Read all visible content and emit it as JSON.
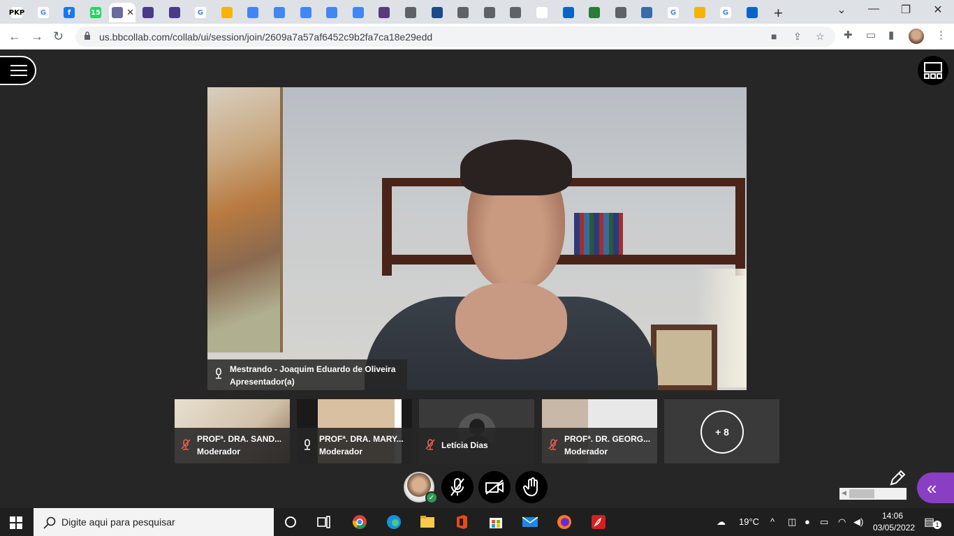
{
  "browser": {
    "url": "us.bbcollab.com/collab/ui/session/join/2609a7a57af6452c9b2fa7ca18e29edd",
    "tabs": [
      {
        "icon": "pkp-icon",
        "text": "PKP",
        "color": "#ffffff",
        "fg": "#000000"
      },
      {
        "icon": "google-icon",
        "text": "G",
        "color": "#ffffff",
        "fg": "#4285f4"
      },
      {
        "icon": "facebook-icon",
        "text": "f",
        "color": "#1877f2",
        "fg": "#ffffff"
      },
      {
        "icon": "whatsapp-icon",
        "text": "15",
        "color": "#25d366",
        "fg": "#ffffff"
      },
      {
        "icon": "collab-icon",
        "text": "",
        "color": "#6a6aa0",
        "fg": "#ffffff"
      },
      {
        "icon": "collab-icon",
        "text": "",
        "color": "#4a3a8a",
        "fg": "#ffffff"
      },
      {
        "icon": "collab-icon",
        "text": "",
        "color": "#4a3a8a",
        "fg": "#ffffff"
      },
      {
        "icon": "google-icon",
        "text": "G",
        "color": "#ffffff",
        "fg": "#4285f4"
      },
      {
        "icon": "slides-icon",
        "text": "",
        "color": "#f4b400",
        "fg": "#ffffff"
      },
      {
        "icon": "docs-icon",
        "text": "",
        "color": "#4285f4",
        "fg": "#ffffff"
      },
      {
        "icon": "docs-icon",
        "text": "",
        "color": "#4285f4",
        "fg": "#ffffff"
      },
      {
        "icon": "docs-icon",
        "text": "",
        "color": "#4285f4",
        "fg": "#ffffff"
      },
      {
        "icon": "docs-icon",
        "text": "",
        "color": "#4285f4",
        "fg": "#ffffff"
      },
      {
        "icon": "docs-icon",
        "text": "",
        "color": "#4285f4",
        "fg": "#ffffff"
      },
      {
        "icon": "tor-icon",
        "text": "",
        "color": "#5a3a7a",
        "fg": "#ffffff"
      },
      {
        "icon": "globe-icon",
        "text": "",
        "color": "#5f6368",
        "fg": "#ffffff"
      },
      {
        "icon": "inbox-icon",
        "text": "",
        "color": "#1a4a8a",
        "fg": "#ffffff"
      },
      {
        "icon": "globe-icon",
        "text": "",
        "color": "#5f6368",
        "fg": "#ffffff"
      },
      {
        "icon": "globe-icon",
        "text": "",
        "color": "#5f6368",
        "fg": "#ffffff"
      },
      {
        "icon": "globe-icon",
        "text": "",
        "color": "#5f6368",
        "fg": "#ffffff"
      },
      {
        "icon": "loading-icon",
        "text": "",
        "color": "#ffffff",
        "fg": "#1a73e8"
      },
      {
        "icon": "outlook-icon",
        "text": "",
        "color": "#0a64c8",
        "fg": "#ffffff"
      },
      {
        "icon": "drive-icon",
        "text": "",
        "color": "#2a7a3a",
        "fg": "#ffffff"
      },
      {
        "icon": "globe-icon",
        "text": "",
        "color": "#5f6368",
        "fg": "#ffffff"
      },
      {
        "icon": "globe-icon",
        "text": "",
        "color": "#3a6aaa",
        "fg": "#ffffff"
      },
      {
        "icon": "google-icon",
        "text": "G",
        "color": "#ffffff",
        "fg": "#4285f4"
      },
      {
        "icon": "drive-icon",
        "text": "",
        "color": "#f4b400",
        "fg": "#ffffff"
      },
      {
        "icon": "google-icon",
        "text": "G",
        "color": "#ffffff",
        "fg": "#4285f4"
      },
      {
        "icon": "outlook-icon",
        "text": "",
        "color": "#0a64c8",
        "fg": "#ffffff"
      }
    ],
    "active_tab_index": 4
  },
  "presenter": {
    "name": "Mestrando - Joaquim Eduardo de Oliveira",
    "role": "Apresentador(a)"
  },
  "participants": [
    {
      "name": "PROFª. DRA. SAND...",
      "role": "Moderador",
      "muted": true
    },
    {
      "name": "PROFª. DRA. MARY...",
      "role": "Moderador",
      "muted": false
    },
    {
      "name": "Letícia Dias",
      "role": "",
      "muted": true
    },
    {
      "name": "PROFª. DR. GEORG...",
      "role": "Moderador",
      "muted": true
    }
  ],
  "more_count": "+ 8",
  "taskbar": {
    "search_placeholder": "Digite aqui para pesquisar",
    "temperature": "19°C",
    "time": "14:06",
    "date": "03/05/2022",
    "notifications": "1"
  },
  "colors": {
    "accent": "#8a3ec4",
    "background": "#262626",
    "muted_mic": "#e86050"
  }
}
